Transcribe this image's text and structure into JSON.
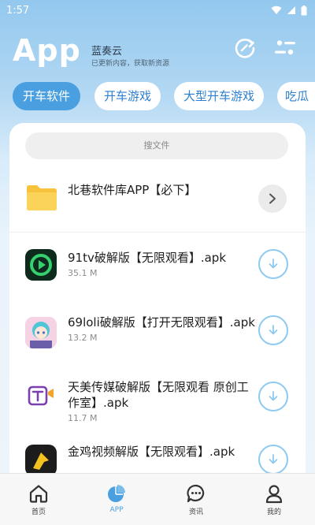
{
  "status_bar": {
    "time": "1:57"
  },
  "header": {
    "app_title": "App",
    "brand_name": "蓝奏云",
    "brand_subtitle": "已更新内容，获取新资源"
  },
  "tabs": [
    {
      "label": "开车软件",
      "active": true
    },
    {
      "label": "开车游戏",
      "active": false
    },
    {
      "label": "大型开车游戏",
      "active": false
    },
    {
      "label": "吃瓜",
      "active": false
    }
  ],
  "search": {
    "placeholder": "搜文件"
  },
  "folder": {
    "title": "北巷软件库APP【必下】"
  },
  "files": [
    {
      "title": "91tv破解版【无限观看】.apk",
      "size": "35.1 M",
      "icon": "play-app-icon"
    },
    {
      "title": "69loli破解版【打开无限观看】.apk",
      "size": "13.2 M",
      "icon": "anime-app-icon"
    },
    {
      "title": "天美传媒破解版【无限观看 原创工",
      "title_line2": "作室】.apk",
      "size": "11.7 M",
      "icon": "tianmei-app-icon"
    },
    {
      "title": "金鸡视频解版【无限观看】.apk",
      "size": "",
      "icon": "golden-chicken-app-icon"
    }
  ],
  "nav": [
    {
      "label": "首页",
      "icon": "home-icon",
      "active": false
    },
    {
      "label": "APP",
      "icon": "pie-chart-icon",
      "active": true
    },
    {
      "label": "资讯",
      "icon": "chat-bubble-icon",
      "active": false
    },
    {
      "label": "我的",
      "icon": "person-icon",
      "active": false
    }
  ],
  "colors": {
    "accent": "#4a9fe0",
    "download_ring": "#8ccaf1",
    "folder": "#f9c23c"
  }
}
